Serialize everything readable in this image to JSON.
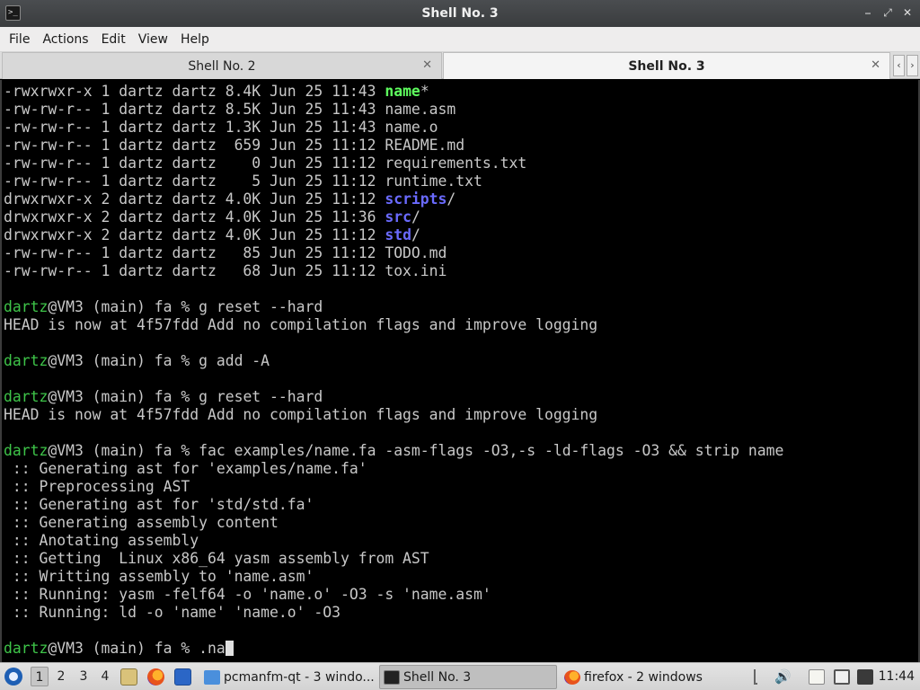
{
  "window": {
    "title": "Shell No. 3",
    "app_icon_text": ">_"
  },
  "menu": [
    "File",
    "Actions",
    "Edit",
    "View",
    "Help"
  ],
  "tabs": [
    {
      "label": "Shell No. 2",
      "active": false
    },
    {
      "label": "Shell No. 3",
      "active": true
    }
  ],
  "terminal": {
    "lines": [
      [
        [
          "-rwxrwxr-x 1 dartz dartz 8.4K Jun 25 11:43 ",
          ""
        ],
        [
          "name",
          "c-bgreen"
        ],
        [
          "*",
          ""
        ]
      ],
      [
        [
          "-rw-rw-r-- 1 dartz dartz 8.5K Jun 25 11:43 name.asm",
          ""
        ]
      ],
      [
        [
          "-rw-rw-r-- 1 dartz dartz 1.3K Jun 25 11:43 name.o",
          ""
        ]
      ],
      [
        [
          "-rw-rw-r-- 1 dartz dartz  659 Jun 25 11:12 README.md",
          ""
        ]
      ],
      [
        [
          "-rw-rw-r-- 1 dartz dartz    0 Jun 25 11:12 requirements.txt",
          ""
        ]
      ],
      [
        [
          "-rw-rw-r-- 1 dartz dartz    5 Jun 25 11:12 runtime.txt",
          ""
        ]
      ],
      [
        [
          "drwxrwxr-x 2 dartz dartz 4.0K Jun 25 11:12 ",
          ""
        ],
        [
          "scripts",
          "c-blue"
        ],
        [
          "/",
          ""
        ]
      ],
      [
        [
          "drwxrwxr-x 2 dartz dartz 4.0K Jun 25 11:36 ",
          ""
        ],
        [
          "src",
          "c-blue"
        ],
        [
          "/",
          ""
        ]
      ],
      [
        [
          "drwxrwxr-x 2 dartz dartz 4.0K Jun 25 11:12 ",
          ""
        ],
        [
          "std",
          "c-blue"
        ],
        [
          "/",
          ""
        ]
      ],
      [
        [
          "-rw-rw-r-- 1 dartz dartz   85 Jun 25 11:12 TODO.md",
          ""
        ]
      ],
      [
        [
          "-rw-rw-r-- 1 dartz dartz   68 Jun 25 11:12 tox.ini",
          ""
        ]
      ],
      [],
      [
        [
          "dartz",
          "c-green"
        ],
        [
          "@VM3 (main) fa % g reset --hard",
          ""
        ]
      ],
      [
        [
          "HEAD is now at 4f57fdd Add no compilation flags and improve logging",
          ""
        ]
      ],
      [],
      [
        [
          "dartz",
          "c-green"
        ],
        [
          "@VM3 (main) fa % g add -A",
          ""
        ]
      ],
      [],
      [
        [
          "dartz",
          "c-green"
        ],
        [
          "@VM3 (main) fa % g reset --hard",
          ""
        ]
      ],
      [
        [
          "HEAD is now at 4f57fdd Add no compilation flags and improve logging",
          ""
        ]
      ],
      [],
      [
        [
          "dartz",
          "c-green"
        ],
        [
          "@VM3 (main) fa % fac examples/name.fa -asm-flags -O3,-s -ld-flags -O3 && strip name",
          ""
        ]
      ],
      [
        [
          " :: Generating ast for 'examples/name.fa'",
          ""
        ]
      ],
      [
        [
          " :: Preprocessing AST",
          ""
        ]
      ],
      [
        [
          " :: Generating ast for 'std/std.fa'",
          ""
        ]
      ],
      [
        [
          " :: Generating assembly content",
          ""
        ]
      ],
      [
        [
          " :: Anotating assembly",
          ""
        ]
      ],
      [
        [
          " :: Getting  Linux x86_64 yasm assembly from AST",
          ""
        ]
      ],
      [
        [
          " :: Writting assembly to 'name.asm'",
          ""
        ]
      ],
      [
        [
          " :: Running: yasm -felf64 -o 'name.o' -O3 -s 'name.asm'",
          ""
        ]
      ],
      [
        [
          " :: Running: ld -o 'name' 'name.o' -O3",
          ""
        ]
      ],
      [],
      [
        [
          "dartz",
          "c-green"
        ],
        [
          "@VM3 (main) fa % .na",
          ""
        ]
      ]
    ]
  },
  "taskbar": {
    "desktops": [
      "1",
      "2",
      "3",
      "4"
    ],
    "active_desktop": "1",
    "tasks": [
      {
        "label": "pcmanfm-qt - 3 windo...",
        "icon": "folder-icon",
        "active": false
      },
      {
        "label": "Shell No. 3",
        "icon": "terminal-icon",
        "active": true
      },
      {
        "label": "firefox - 2 windows",
        "icon": "firefox-icon",
        "active": false
      }
    ],
    "clock": "11:44"
  },
  "colors": {
    "prompt_user": "#3ec449",
    "executable": "#5eff5e",
    "directory": "#6a6aff",
    "terminal_bg": "#000000",
    "terminal_fg": "#c8c8c8"
  }
}
